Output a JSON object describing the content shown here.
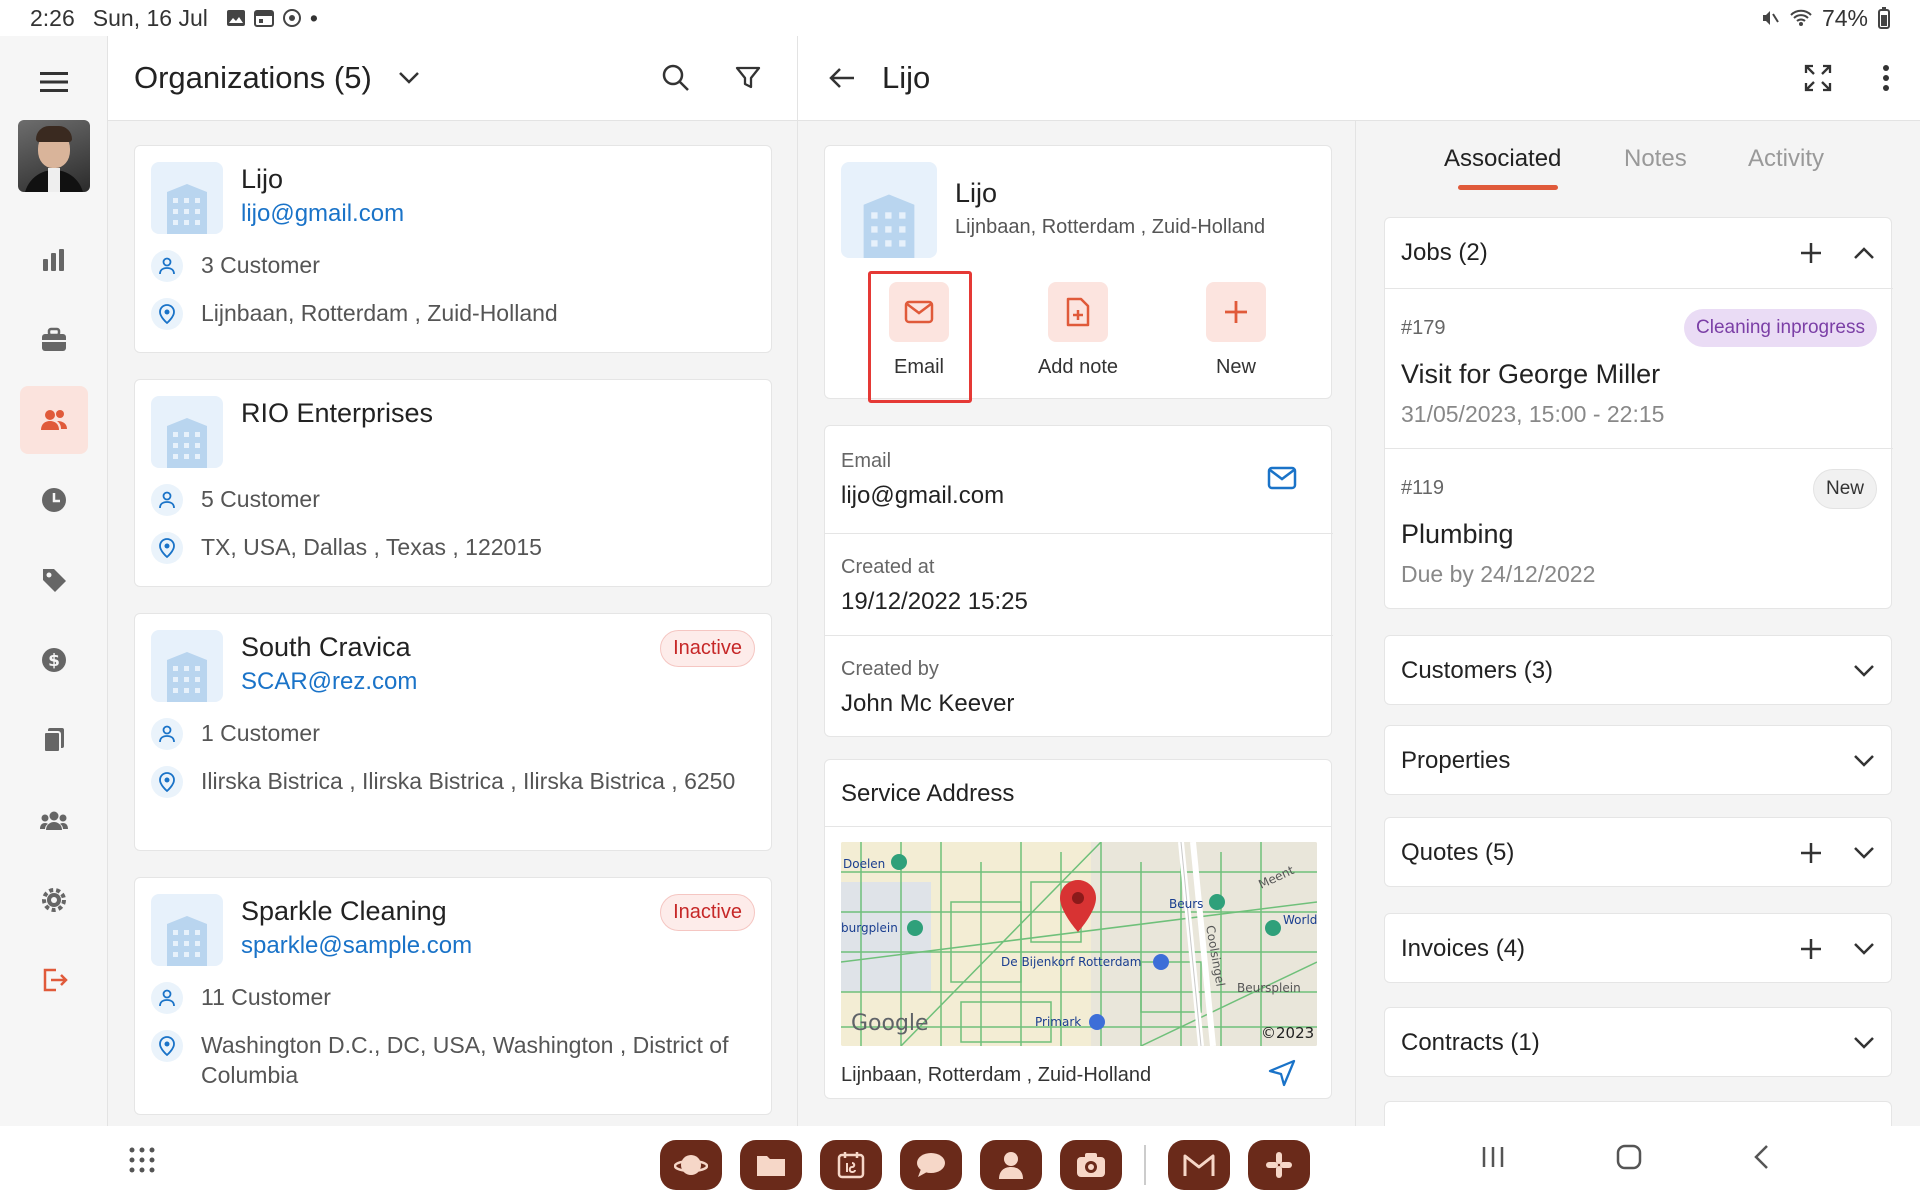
{
  "statusbar": {
    "time": "2:26",
    "date": "Sun, 16 Jul",
    "battery": "74%"
  },
  "org_panel": {
    "title": "Organizations (5)"
  },
  "organizations": [
    {
      "name": "Lijo",
      "email": "lijo@gmail.com",
      "customers": "3 Customer",
      "address": "Lijnbaan, Rotterdam , Zuid-Holland",
      "badge": ""
    },
    {
      "name": "RIO Enterprises",
      "email": "",
      "customers": "5 Customer",
      "address": "TX, USA, Dallas , Texas , 122015",
      "badge": ""
    },
    {
      "name": "South Cravica",
      "email": "SCAR@rez.com",
      "customers": "1 Customer",
      "address": "Ilirska Bistrica , Ilirska Bistrica , Ilirska Bistrica , 6250",
      "badge": "Inactive"
    },
    {
      "name": "Sparkle Cleaning",
      "email": "sparkle@sample.com",
      "customers": "11 Customer",
      "address": "Washington D.C., DC, USA, Washington , District of Columbia",
      "badge": "Inactive"
    }
  ],
  "detail": {
    "title": "Lijo",
    "name": "Lijo",
    "address": "Lijnbaan, Rotterdam , Zuid-Holland",
    "actions": {
      "email": "Email",
      "add_note": "Add note",
      "new": "New"
    },
    "email_label": "Email",
    "email_value": "lijo@gmail.com",
    "created_at_label": "Created at",
    "created_at_value": "19/12/2022 15:25",
    "created_by_label": "Created by",
    "created_by_value": "John Mc Keever",
    "service_address_title": "Service Address",
    "service_address": "Lijnbaan, Rotterdam , Zuid-Holland",
    "map": {
      "labels": [
        "Doelen",
        "burgplein",
        "Beurs",
        "Meent",
        "World Cent",
        "De Bijenkorf Rotterdam",
        "Coolsingel",
        "Beursplein",
        "Primark",
        "Google",
        "©2023"
      ]
    }
  },
  "tabs": {
    "associated": "Associated",
    "notes": "Notes",
    "activity": "Activity"
  },
  "sections": {
    "jobs": "Jobs (2)",
    "customers": "Customers (3)",
    "properties": "Properties",
    "quotes": "Quotes (5)",
    "invoices": "Invoices (4)",
    "contracts": "Contracts (1)"
  },
  "jobs": [
    {
      "num": "#179",
      "title": "Visit for George Miller",
      "sub": "31/05/2023, 15:00 - 22:15",
      "status": "Cleaning inprogress"
    },
    {
      "num": "#119",
      "title": "Plumbing",
      "sub": "Due by 24/12/2022",
      "status": "New"
    }
  ],
  "colors": {
    "accent": "#e05a3a",
    "link": "#1a73c8",
    "inactive": "#c62828",
    "status_purple_bg": "#eadcf5",
    "status_purple_text": "#7b3fa6"
  }
}
